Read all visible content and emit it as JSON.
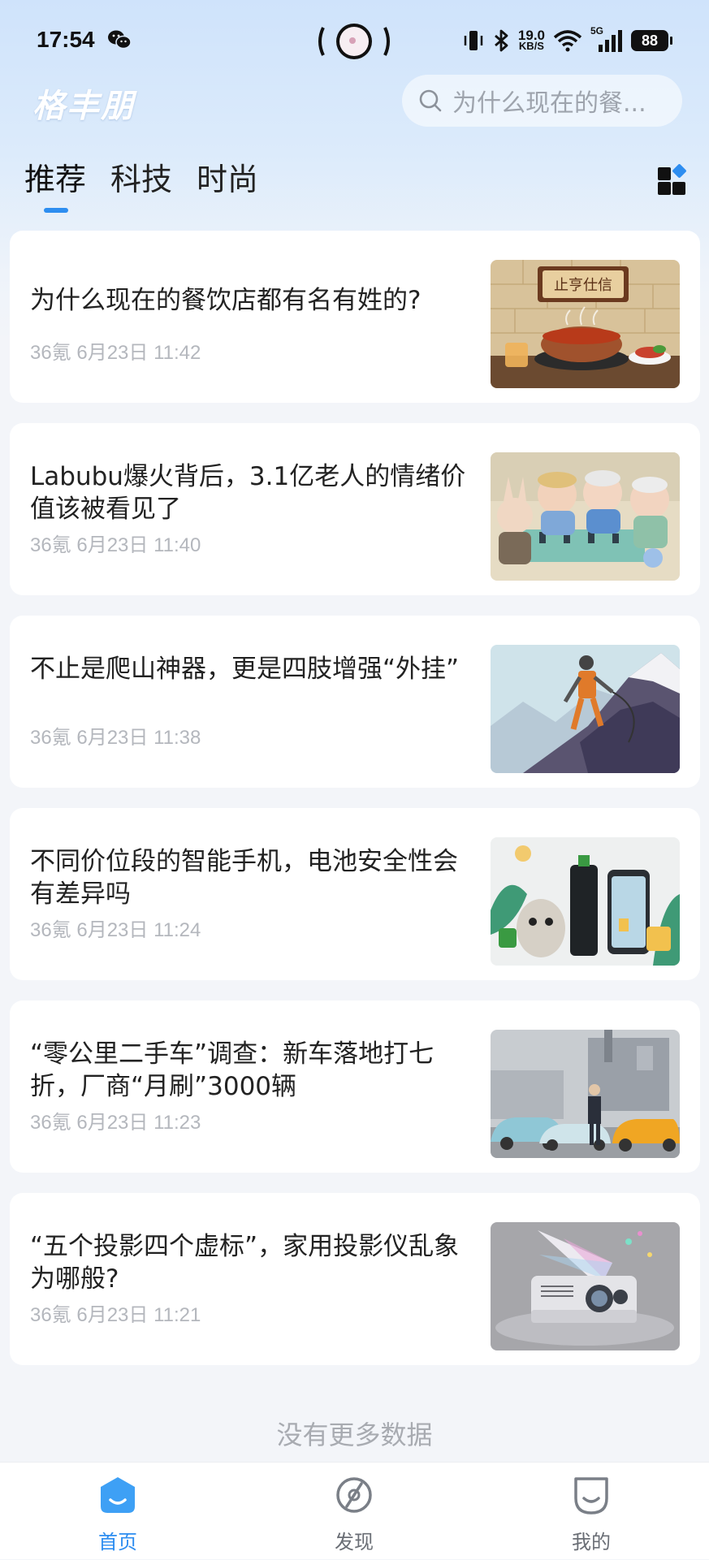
{
  "status_bar": {
    "time": "17:54",
    "net_speed_value": "19.0",
    "net_speed_unit": "KB/S",
    "network_type": "5G",
    "battery": "88"
  },
  "header": {
    "logo": "格丰朋",
    "search_placeholder": "为什么现在的餐..."
  },
  "tabs": [
    {
      "label": "推荐",
      "active": true
    },
    {
      "label": "科技",
      "active": false
    },
    {
      "label": "时尚",
      "active": false
    }
  ],
  "articles": [
    {
      "title": "为什么现在的餐饮店都有名有姓的?",
      "meta": "36氪 6月23日 11:42",
      "thumb_sign": "止亨仕信"
    },
    {
      "title": "Labubu爆火背后，3.1亿老人的情绪价值该被看见了",
      "meta": "36氪 6月23日 11:40"
    },
    {
      "title": "不止是爬山神器，更是四肢增强“外挂”",
      "meta": "36氪 6月23日 11:38"
    },
    {
      "title": "不同价位段的智能手机，电池安全性会有差异吗",
      "meta": "36氪 6月23日 11:24"
    },
    {
      "title": "“零公里二手车”调查：新车落地打七折，厂商“月刷”3000辆",
      "meta": "36氪 6月23日 11:23"
    },
    {
      "title": "“五个投影四个虚标”，家用投影仪乱象为哪般?",
      "meta": "36氪 6月23日 11:21"
    }
  ],
  "footer_text": "没有更多数据",
  "bottom_nav": [
    {
      "label": "首页",
      "icon": "home-icon",
      "active": true
    },
    {
      "label": "发现",
      "icon": "discover-icon",
      "active": false
    },
    {
      "label": "我的",
      "icon": "profile-icon",
      "active": false
    }
  ],
  "colors": {
    "accent": "#2d8df0",
    "card_bg": "#ffffff",
    "meta_text": "#b4b7bd"
  }
}
